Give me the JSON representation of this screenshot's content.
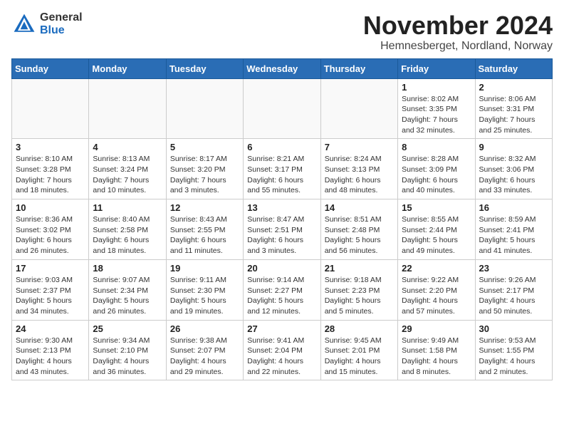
{
  "logo": {
    "general": "General",
    "blue": "Blue"
  },
  "title": "November 2024",
  "location": "Hemnesberget, Nordland, Norway",
  "weekdays": [
    "Sunday",
    "Monday",
    "Tuesday",
    "Wednesday",
    "Thursday",
    "Friday",
    "Saturday"
  ],
  "weeks": [
    [
      {
        "day": "",
        "info": ""
      },
      {
        "day": "",
        "info": ""
      },
      {
        "day": "",
        "info": ""
      },
      {
        "day": "",
        "info": ""
      },
      {
        "day": "",
        "info": ""
      },
      {
        "day": "1",
        "info": "Sunrise: 8:02 AM\nSunset: 3:35 PM\nDaylight: 7 hours\nand 32 minutes."
      },
      {
        "day": "2",
        "info": "Sunrise: 8:06 AM\nSunset: 3:31 PM\nDaylight: 7 hours\nand 25 minutes."
      }
    ],
    [
      {
        "day": "3",
        "info": "Sunrise: 8:10 AM\nSunset: 3:28 PM\nDaylight: 7 hours\nand 18 minutes."
      },
      {
        "day": "4",
        "info": "Sunrise: 8:13 AM\nSunset: 3:24 PM\nDaylight: 7 hours\nand 10 minutes."
      },
      {
        "day": "5",
        "info": "Sunrise: 8:17 AM\nSunset: 3:20 PM\nDaylight: 7 hours\nand 3 minutes."
      },
      {
        "day": "6",
        "info": "Sunrise: 8:21 AM\nSunset: 3:17 PM\nDaylight: 6 hours\nand 55 minutes."
      },
      {
        "day": "7",
        "info": "Sunrise: 8:24 AM\nSunset: 3:13 PM\nDaylight: 6 hours\nand 48 minutes."
      },
      {
        "day": "8",
        "info": "Sunrise: 8:28 AM\nSunset: 3:09 PM\nDaylight: 6 hours\nand 40 minutes."
      },
      {
        "day": "9",
        "info": "Sunrise: 8:32 AM\nSunset: 3:06 PM\nDaylight: 6 hours\nand 33 minutes."
      }
    ],
    [
      {
        "day": "10",
        "info": "Sunrise: 8:36 AM\nSunset: 3:02 PM\nDaylight: 6 hours\nand 26 minutes."
      },
      {
        "day": "11",
        "info": "Sunrise: 8:40 AM\nSunset: 2:58 PM\nDaylight: 6 hours\nand 18 minutes."
      },
      {
        "day": "12",
        "info": "Sunrise: 8:43 AM\nSunset: 2:55 PM\nDaylight: 6 hours\nand 11 minutes."
      },
      {
        "day": "13",
        "info": "Sunrise: 8:47 AM\nSunset: 2:51 PM\nDaylight: 6 hours\nand 3 minutes."
      },
      {
        "day": "14",
        "info": "Sunrise: 8:51 AM\nSunset: 2:48 PM\nDaylight: 5 hours\nand 56 minutes."
      },
      {
        "day": "15",
        "info": "Sunrise: 8:55 AM\nSunset: 2:44 PM\nDaylight: 5 hours\nand 49 minutes."
      },
      {
        "day": "16",
        "info": "Sunrise: 8:59 AM\nSunset: 2:41 PM\nDaylight: 5 hours\nand 41 minutes."
      }
    ],
    [
      {
        "day": "17",
        "info": "Sunrise: 9:03 AM\nSunset: 2:37 PM\nDaylight: 5 hours\nand 34 minutes."
      },
      {
        "day": "18",
        "info": "Sunrise: 9:07 AM\nSunset: 2:34 PM\nDaylight: 5 hours\nand 26 minutes."
      },
      {
        "day": "19",
        "info": "Sunrise: 9:11 AM\nSunset: 2:30 PM\nDaylight: 5 hours\nand 19 minutes."
      },
      {
        "day": "20",
        "info": "Sunrise: 9:14 AM\nSunset: 2:27 PM\nDaylight: 5 hours\nand 12 minutes."
      },
      {
        "day": "21",
        "info": "Sunrise: 9:18 AM\nSunset: 2:23 PM\nDaylight: 5 hours\nand 5 minutes."
      },
      {
        "day": "22",
        "info": "Sunrise: 9:22 AM\nSunset: 2:20 PM\nDaylight: 4 hours\nand 57 minutes."
      },
      {
        "day": "23",
        "info": "Sunrise: 9:26 AM\nSunset: 2:17 PM\nDaylight: 4 hours\nand 50 minutes."
      }
    ],
    [
      {
        "day": "24",
        "info": "Sunrise: 9:30 AM\nSunset: 2:13 PM\nDaylight: 4 hours\nand 43 minutes."
      },
      {
        "day": "25",
        "info": "Sunrise: 9:34 AM\nSunset: 2:10 PM\nDaylight: 4 hours\nand 36 minutes."
      },
      {
        "day": "26",
        "info": "Sunrise: 9:38 AM\nSunset: 2:07 PM\nDaylight: 4 hours\nand 29 minutes."
      },
      {
        "day": "27",
        "info": "Sunrise: 9:41 AM\nSunset: 2:04 PM\nDaylight: 4 hours\nand 22 minutes."
      },
      {
        "day": "28",
        "info": "Sunrise: 9:45 AM\nSunset: 2:01 PM\nDaylight: 4 hours\nand 15 minutes."
      },
      {
        "day": "29",
        "info": "Sunrise: 9:49 AM\nSunset: 1:58 PM\nDaylight: 4 hours\nand 8 minutes."
      },
      {
        "day": "30",
        "info": "Sunrise: 9:53 AM\nSunset: 1:55 PM\nDaylight: 4 hours\nand 2 minutes."
      }
    ]
  ]
}
